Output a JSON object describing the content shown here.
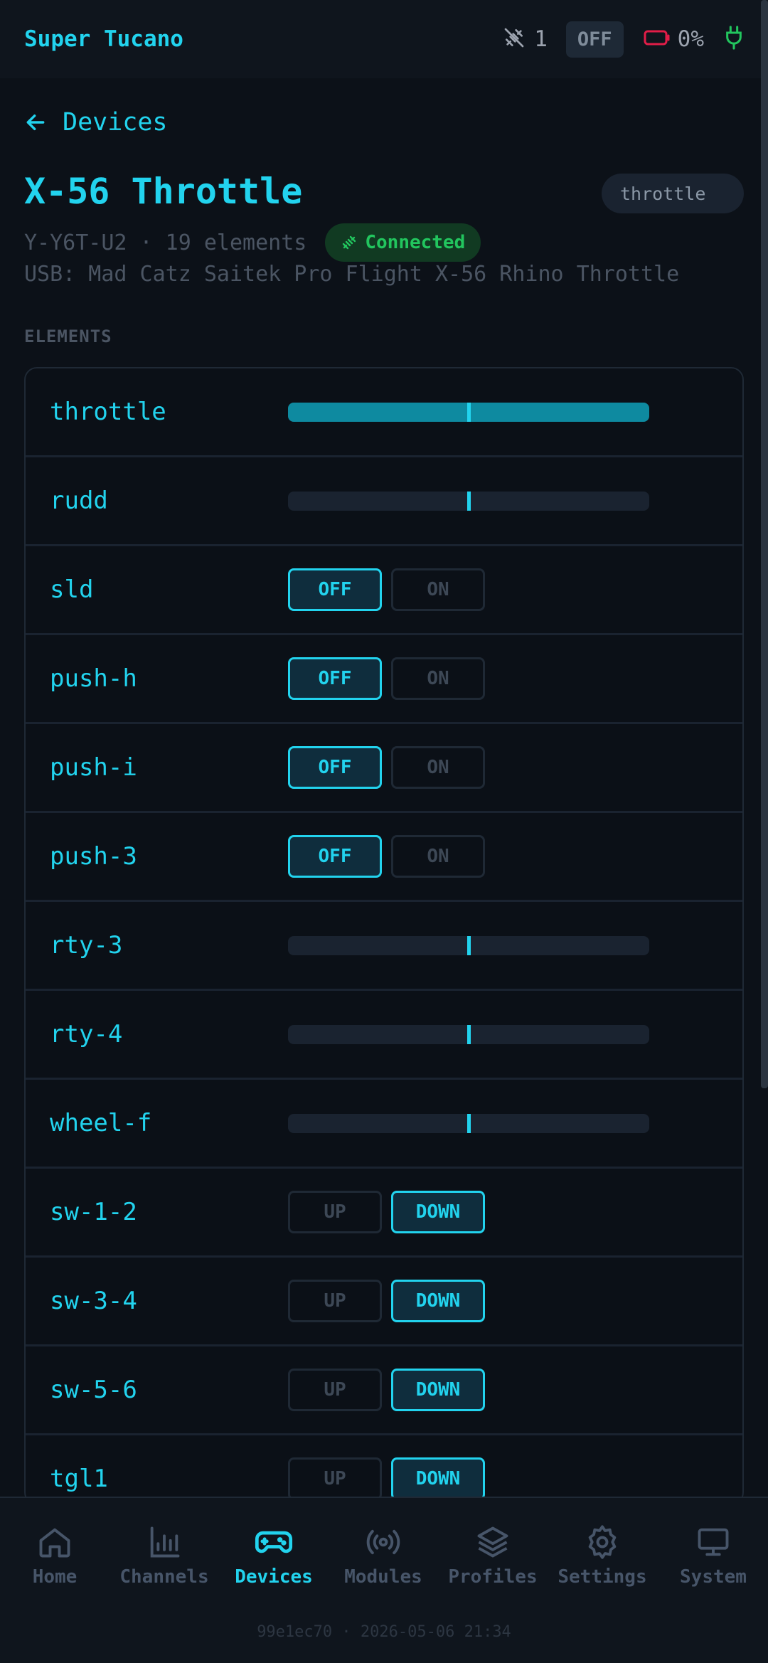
{
  "app": {
    "title": "Super Tucano"
  },
  "status": {
    "link_count": "1",
    "mode": "OFF",
    "battery": "0%"
  },
  "nav": {
    "back_label": "Devices"
  },
  "device": {
    "title": "X-56 Throttle",
    "type_pill": "throttle",
    "meta": "Y-Y6T-U2 · 19 elements",
    "connection": "Connected",
    "usb": "USB: Mad Catz Saitek Pro Flight X-56 Rhino Throttle"
  },
  "section": {
    "label": "ELEMENTS"
  },
  "elements": [
    {
      "name": "throttle",
      "kind": "axis",
      "value": 0.5,
      "filled": true
    },
    {
      "name": "rudd",
      "kind": "axis",
      "value": 0.5,
      "filled": false
    },
    {
      "name": "sld",
      "kind": "toggle",
      "opt1": "OFF",
      "opt2": "ON",
      "selected": 1
    },
    {
      "name": "push-h",
      "kind": "toggle",
      "opt1": "OFF",
      "opt2": "ON",
      "selected": 1
    },
    {
      "name": "push-i",
      "kind": "toggle",
      "opt1": "OFF",
      "opt2": "ON",
      "selected": 1
    },
    {
      "name": "push-3",
      "kind": "toggle",
      "opt1": "OFF",
      "opt2": "ON",
      "selected": 1
    },
    {
      "name": "rty-3",
      "kind": "axis",
      "value": 0.5,
      "filled": false
    },
    {
      "name": "rty-4",
      "kind": "axis",
      "value": 0.5,
      "filled": false
    },
    {
      "name": "wheel-f",
      "kind": "axis",
      "value": 0.5,
      "filled": false
    },
    {
      "name": "sw-1-2",
      "kind": "toggle",
      "opt1": "UP",
      "opt2": "DOWN",
      "selected": 2
    },
    {
      "name": "sw-3-4",
      "kind": "toggle",
      "opt1": "UP",
      "opt2": "DOWN",
      "selected": 2
    },
    {
      "name": "sw-5-6",
      "kind": "toggle",
      "opt1": "UP",
      "opt2": "DOWN",
      "selected": 2
    },
    {
      "name": "tgl1",
      "kind": "toggle",
      "opt1": "UP",
      "opt2": "DOWN",
      "selected": 2
    }
  ],
  "bottom_nav": {
    "home": "Home",
    "channels": "Channels",
    "devices": "Devices",
    "modules": "Modules",
    "profiles": "Profiles",
    "settings": "Settings",
    "system": "System",
    "active": "devices"
  },
  "footer": {
    "build": "99e1ec70 · 2026-05-06 21:34"
  },
  "colors": {
    "accent": "#22d3ee",
    "success": "#22c55e",
    "battery": "#e11d48"
  }
}
